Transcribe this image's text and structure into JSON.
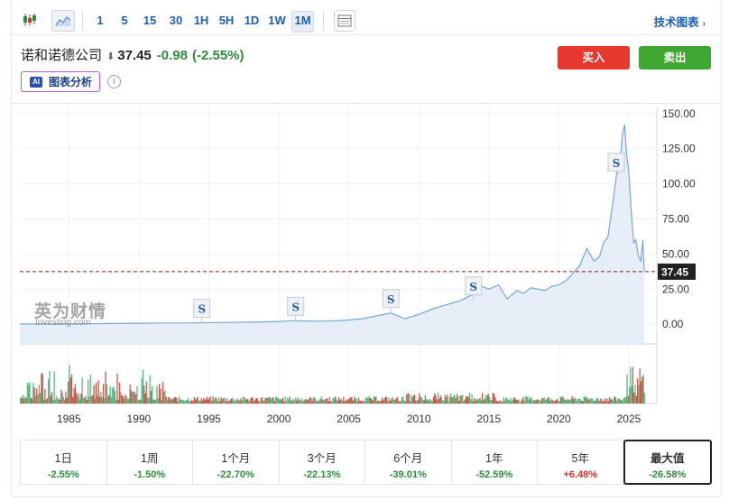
{
  "toolbar": {
    "icons": [
      "candlestick-icon",
      "area-chart-icon",
      "table-icon"
    ],
    "timeframes": [
      "1",
      "5",
      "15",
      "30",
      "1H",
      "5H",
      "1D",
      "1W",
      "1M"
    ],
    "active_timeframe": "1M",
    "tech_chart_label": "技术图表",
    "tech_chart_chevron": "›"
  },
  "quote": {
    "name": "诺和诺德公司",
    "direction": "down",
    "price": "37.45",
    "change": "-0.98",
    "change_pct": "(-2.55%)"
  },
  "actions": {
    "buy": "买入",
    "sell": "卖出"
  },
  "ai_chart": {
    "badge": "AI",
    "label": "图表分析",
    "info": "i"
  },
  "watermark": {
    "brand": "英为财情",
    "sub": "Investing.com"
  },
  "chart_data": {
    "type": "area",
    "series": [
      {
        "x": [
          1984.5,
          1986,
          1988,
          1990,
          1992,
          1994,
          1996,
          1998,
          2000,
          2001,
          2002,
          2003,
          2004,
          2005,
          2006,
          2007,
          2008,
          2008.5,
          2009,
          2010,
          2011,
          2012,
          2013,
          2014,
          2014.5,
          2015,
          2015.7,
          2016.3,
          2017,
          2017.5,
          2018,
          2019,
          2019.5,
          2020,
          2020.5,
          2021,
          2021.5,
          2022,
          2022.5,
          2022.9,
          2023.2,
          2023.5,
          2023.8,
          2024.1,
          2024.4,
          2024.55,
          2024.7,
          2024.85,
          2025.0,
          2025.2,
          2025.35,
          2025.5,
          2025.7,
          2025.85,
          2026.0,
          2026.1
        ],
        "y": [
          0.2,
          0.3,
          0.5,
          0.7,
          0.9,
          1.0,
          1.2,
          1.5,
          2,
          2.5,
          2.3,
          2.2,
          2.5,
          3,
          4,
          6,
          8,
          6,
          4,
          7,
          11,
          14,
          17,
          22,
          27,
          25,
          28,
          18,
          24,
          22,
          26,
          24,
          27,
          28,
          31,
          36,
          42,
          54,
          45,
          48,
          58,
          62,
          82,
          105,
          118,
          136,
          142,
          120,
          108,
          76,
          58,
          60,
          48,
          45,
          60,
          37.45
        ]
      }
    ],
    "last_value": 37.45,
    "last_label": "37.45",
    "ylim": [
      -14,
      155
    ],
    "y_ticks": [
      0,
      25,
      50,
      75,
      100,
      125,
      150
    ],
    "y_tick_labels": [
      "0.00",
      "25.00",
      "50.00",
      "75.00",
      "100.00",
      "125.00",
      "150.00"
    ],
    "x_ticks": [
      1985,
      1990,
      1995,
      2000,
      2005,
      2010,
      2015,
      2020,
      2025
    ],
    "x_tick_labels": [
      "1985",
      "1990",
      "1995",
      "2000",
      "2005",
      "2010",
      "2015",
      "2020",
      "2025"
    ],
    "xlim": [
      1981.5,
      2027
    ],
    "dividend_markers": {
      "symbol": "S",
      "x": [
        1994.5,
        2001.2,
        2008,
        2013.9,
        2024.1
      ]
    },
    "volume": {
      "note_free": true
    },
    "grid": true,
    "colors": {
      "line": "#7aa6d6",
      "fill": "#e6eef7",
      "price_line": "#8b1a1a",
      "label_bg": "#222222",
      "vol_up": "#3ea86a",
      "vol_down": "#c0392b"
    }
  },
  "periods": [
    {
      "label": "1日",
      "value": "-2.55%",
      "sign": "neg"
    },
    {
      "label": "1周",
      "value": "-1.50%",
      "sign": "neg"
    },
    {
      "label": "1个月",
      "value": "-22.70%",
      "sign": "neg"
    },
    {
      "label": "3个月",
      "value": "-22.13%",
      "sign": "neg"
    },
    {
      "label": "6个月",
      "value": "-39.01%",
      "sign": "neg"
    },
    {
      "label": "1年",
      "value": "-52.59%",
      "sign": "neg"
    },
    {
      "label": "5年",
      "value": "+6.48%",
      "sign": "pos"
    },
    {
      "label": "最大值",
      "value": "-26.58%",
      "sign": "neg",
      "active": true
    }
  ]
}
